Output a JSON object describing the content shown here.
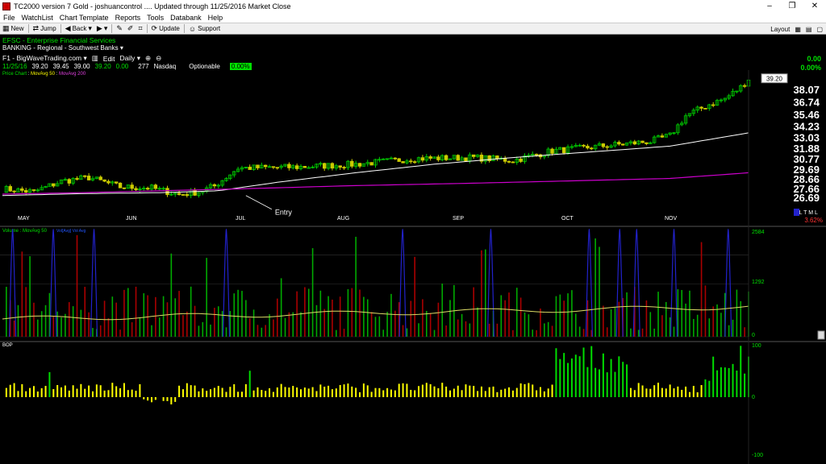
{
  "window": {
    "title": "TC2000 version 7 Gold - joshuancontrol .... Updated through 11/25/2016 Market Close",
    "minimize": "–",
    "restore": "❐",
    "close": "✕"
  },
  "menu": [
    "File",
    "WatchList",
    "Chart Template",
    "Reports",
    "Tools",
    "Databank",
    "Help"
  ],
  "toolbar": {
    "new": "New",
    "jump": "Jump",
    "back": "Back",
    "update": "Update",
    "support": "Support",
    "layout": "Layout"
  },
  "symbol": {
    "name": "EFSC - Enterprise Financial Services",
    "industry": "BANKING - Regional - Southwest Banks",
    "source": "F1 - BigWaveTrading.com",
    "edit": "Edit",
    "period": "Daily",
    "date": "11/25/16",
    "open": "39.20",
    "high": "39.45",
    "low": "39.00",
    "close": "39.20",
    "change": "0.00",
    "volume": "277",
    "exchange": "Nasdaq",
    "optionable": "Optionable",
    "pct_badge": "0.00%",
    "right_change": "0.00",
    "right_pct": "0.00%",
    "price_tag": "39.20",
    "overlay_price": "Price Chart",
    "overlay_ma50": "MovAvg 50",
    "overlay_ma200": "MovAvg 200",
    "annotation": "Entry",
    "scale_label": "AL T M L",
    "scale_pct": "3.62%"
  },
  "price_axis": [
    "38.07",
    "36.74",
    "35.46",
    "34.23",
    "33.03",
    "31.88",
    "30.77",
    "29.69",
    "28.66",
    "27.66",
    "26.69"
  ],
  "months": [
    "MAY",
    "JUN",
    "JUL",
    "AUG",
    "SEP",
    "OCT",
    "NOV"
  ],
  "volume_panel": {
    "title": "Volume",
    "ma": "MovAvg 50",
    "legend": "Vol[Avg] Vol Avg",
    "ticks": [
      "2584",
      "1292",
      "0"
    ]
  },
  "bop_panel": {
    "title": "BOP",
    "ticks": [
      "100",
      "0",
      "-100"
    ]
  },
  "colors": {
    "up": "#00cc00",
    "down": "#cccc00",
    "ma50": "#ffffff",
    "ma200": "#cc00cc",
    "vol_up": "#00aa00",
    "vol_down": "#aa0000",
    "spike": "#2222cc",
    "bop_pos": "#ffff00",
    "bop_green": "#00dd00"
  },
  "chart_data": {
    "type": "candlestick",
    "title": "EFSC - Enterprise Financial Services",
    "x": [
      "May",
      "Jun",
      "Jul",
      "Aug",
      "Sep",
      "Oct",
      "Nov"
    ],
    "ylim": [
      26.2,
      39.6
    ],
    "close_path": [
      [
        0,
        27.6
      ],
      [
        8,
        27.3
      ],
      [
        15,
        28.4
      ],
      [
        22,
        28.8
      ],
      [
        30,
        27.8
      ],
      [
        38,
        27.7
      ],
      [
        45,
        27.0
      ],
      [
        50,
        27.3
      ],
      [
        54,
        27.9
      ],
      [
        60,
        29.8
      ],
      [
        75,
        29.9
      ],
      [
        90,
        30.2
      ],
      [
        105,
        30.8
      ],
      [
        120,
        30.9
      ],
      [
        130,
        30.6
      ],
      [
        140,
        31.6
      ],
      [
        150,
        32.0
      ],
      [
        160,
        32.4
      ],
      [
        165,
        32.6
      ],
      [
        170,
        33.2
      ],
      [
        174,
        35.3
      ],
      [
        180,
        36.5
      ],
      [
        184,
        37.1
      ],
      [
        188,
        38.3
      ],
      [
        190,
        39.2
      ]
    ],
    "ma50": [
      [
        0,
        26.9
      ],
      [
        20,
        27.1
      ],
      [
        40,
        27.2
      ],
      [
        55,
        27.4
      ],
      [
        70,
        28.3
      ],
      [
        90,
        29.3
      ],
      [
        110,
        30.2
      ],
      [
        130,
        30.9
      ],
      [
        150,
        31.5
      ],
      [
        170,
        32.1
      ],
      [
        190,
        33.5
      ]
    ],
    "ma200": [
      [
        0,
        27.05
      ],
      [
        20,
        27.2
      ],
      [
        40,
        27.4
      ],
      [
        60,
        27.6
      ],
      [
        90,
        27.95
      ],
      [
        120,
        28.2
      ],
      [
        150,
        28.5
      ],
      [
        170,
        28.7
      ],
      [
        190,
        29.3
      ]
    ]
  }
}
